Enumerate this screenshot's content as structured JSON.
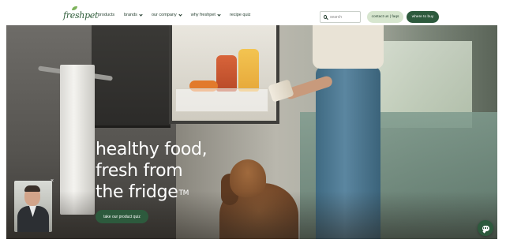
{
  "header": {
    "logo_text": "freshpet",
    "nav": [
      {
        "label": "products",
        "has_dropdown": false
      },
      {
        "label": "brands",
        "has_dropdown": true
      },
      {
        "label": "our company",
        "has_dropdown": true
      },
      {
        "label": "why freshpet",
        "has_dropdown": true
      },
      {
        "label": "recipe quiz",
        "has_dropdown": false
      }
    ],
    "search_placeholder": "search",
    "search_value": "",
    "contact_label": "contact us | faqs",
    "buy_label": "where to buy"
  },
  "hero": {
    "headline_line1": "healthy food,",
    "headline_line2": "fresh from",
    "headline_line3": "the fridge",
    "trademark": "TM",
    "cta_label": "take our product quiz"
  },
  "video_popup": {
    "close_glyph": "×"
  },
  "icons": {
    "search": "search-icon",
    "dropdown": "chevron-down-icon",
    "close": "close-icon",
    "chat": "chat-icon"
  },
  "colors": {
    "brand_green": "#2d5a3d",
    "light_green": "#d7e6cf",
    "nav_text": "#1f3a2a",
    "headline": "#ffffff"
  }
}
